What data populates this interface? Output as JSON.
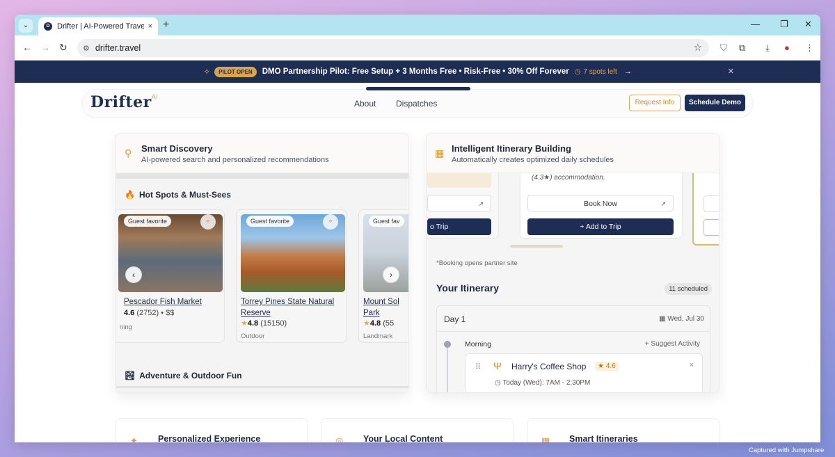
{
  "browser": {
    "tab_title": "Drifter | AI-Powered Travel Planning",
    "url": "drifter.travel",
    "new_tab": "+",
    "tab_close": "×"
  },
  "banner": {
    "pill": "PILOT OPEN",
    "text": "DMO Partnership Pilot: Free Setup + 3 Months Free • Risk-Free • 30% Off Forever",
    "spots": "7 spots left"
  },
  "nav": {
    "logo": "Drifter",
    "logo_sup": "AI",
    "about": "About",
    "dispatches": "Dispatches",
    "request_info": "Request Info",
    "schedule_demo": "Schedule Demo"
  },
  "discovery": {
    "title": "Smart Discovery",
    "subtitle": "AI-powered search and personalized recommendations",
    "section1": "Hot Spots & Must-Sees",
    "section2": "Adventure & Outdoor Fun",
    "places": [
      {
        "badge": "Guest favorite",
        "name": "Pescador Fish Market",
        "rating": "4.6",
        "reviews": "(2752)",
        "price": "$$",
        "category": "ning"
      },
      {
        "badge": "Guest favorite",
        "name": "Torrey Pines State Natural Reserve",
        "rating": "4.8",
        "reviews": "(15150)",
        "category": "Outdoor"
      },
      {
        "badge": "Guest fav",
        "name": "Mount Sol Park",
        "rating": "4.8",
        "reviews": "(55",
        "category": "Landmark"
      }
    ]
  },
  "itinerary": {
    "title": "Intelligent Itinerary Building",
    "subtitle": "Automatically creates optimized daily schedules",
    "accommodation_text": "(4.3★) accommodation.",
    "book_now": "Book Now",
    "add_to_trip": "Add to Trip",
    "add_to_trip_partial": "o Trip",
    "booking_note": "*Booking opens partner site",
    "your_itinerary": "Your Itinerary",
    "scheduled": "11 scheduled",
    "day": "Day 1",
    "date": "Wed, Jul 30",
    "morning": "Morning",
    "suggest": "+ Suggest Activity",
    "activity_name": "Harry's Coffee Shop",
    "activity_rating": "4.6",
    "activity_hours": "Today (Wed): 7AM - 2:30PM"
  },
  "features": {
    "items": [
      "Personalized Experience",
      "Your Local Content",
      "Smart Itineraries"
    ]
  },
  "watermark": "Captured with Jumpshare",
  "colors": {
    "navy": "#1e2d54",
    "gold": "#d9a44d"
  }
}
